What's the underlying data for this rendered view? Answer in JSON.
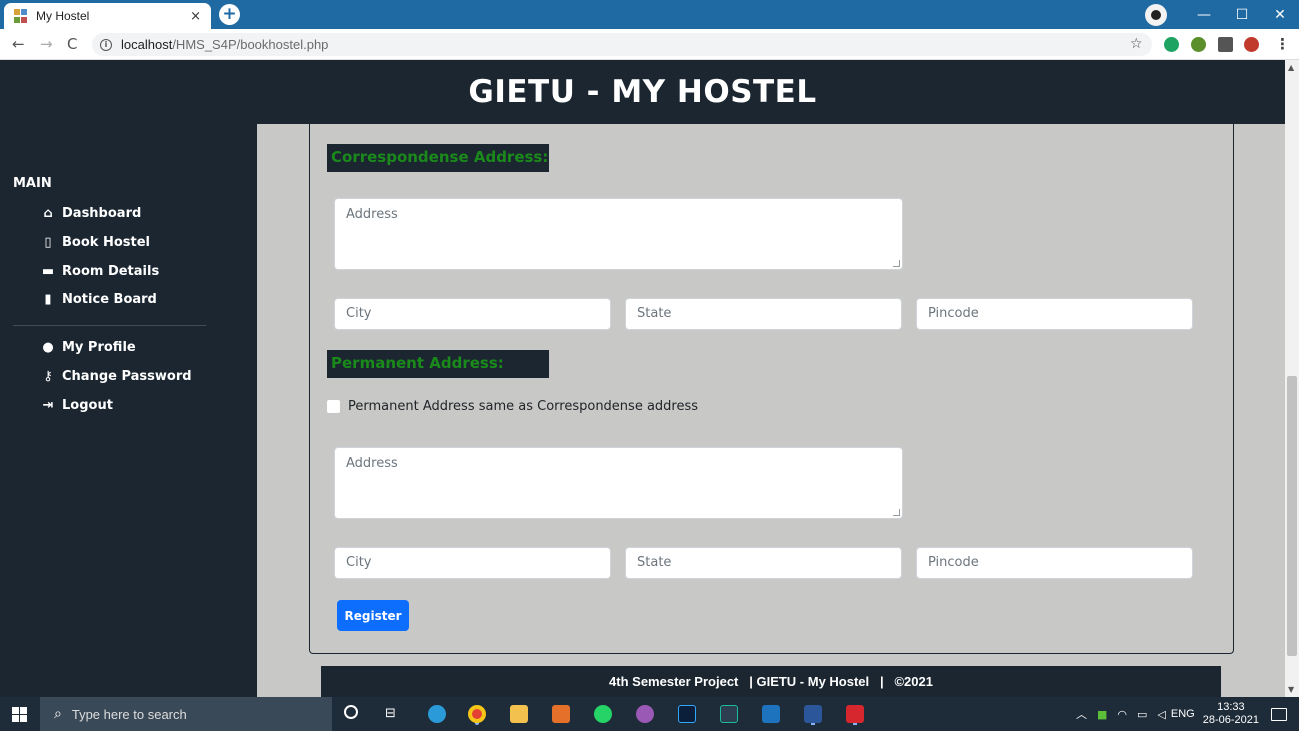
{
  "browser": {
    "tab_title": "My Hostel",
    "tab_close": "×",
    "new_tab": "+",
    "url_host": "localhost",
    "url_path": "/HMS_S4P/bookhostel.php",
    "back": "←",
    "forward": "→",
    "reload": "C",
    "star": "☆",
    "menu": "⋮",
    "minimize": "—",
    "maximize": "☐",
    "close": "✕"
  },
  "header": {
    "title": "GIETU - MY HOSTEL"
  },
  "sidebar": {
    "section": "MAIN",
    "items": [
      {
        "label": "Dashboard",
        "icon": "⌂"
      },
      {
        "label": "Book Hostel",
        "icon": "▯"
      },
      {
        "label": "Room Details",
        "icon": "▬"
      },
      {
        "label": "Notice Board",
        "icon": "▮"
      }
    ],
    "account_items": [
      {
        "label": "My Profile",
        "icon": "●"
      },
      {
        "label": "Change Password",
        "icon": "⚷"
      },
      {
        "label": "Logout",
        "icon": "⇥"
      }
    ]
  },
  "form": {
    "correspondence_label": "Correspondense Address:",
    "permanent_label": "Permanent Address:",
    "same_address_label": "Permanent Address same as Correspondense address",
    "corr_address_placeholder": "Address",
    "corr_city_placeholder": "City",
    "corr_state_placeholder": "State",
    "corr_pincode_placeholder": "Pincode",
    "perm_address_placeholder": "Address",
    "perm_city_placeholder": "City",
    "perm_state_placeholder": "State",
    "perm_pincode_placeholder": "Pincode",
    "register_label": "Register"
  },
  "footer": {
    "text": "4th Semester Project   | GIETU - My Hostel   |   ©2021"
  },
  "taskbar": {
    "search_placeholder": "Type here to search",
    "language": "ENG",
    "time": "13:33",
    "date": "28-06-2021"
  },
  "colors": {
    "header_bg": "#1b2631",
    "page_bg": "#c8c8c7",
    "section_label_text": "#1a8a1a",
    "register_btn": "#0d6efd",
    "tab_strip": "#1f6aa3"
  }
}
